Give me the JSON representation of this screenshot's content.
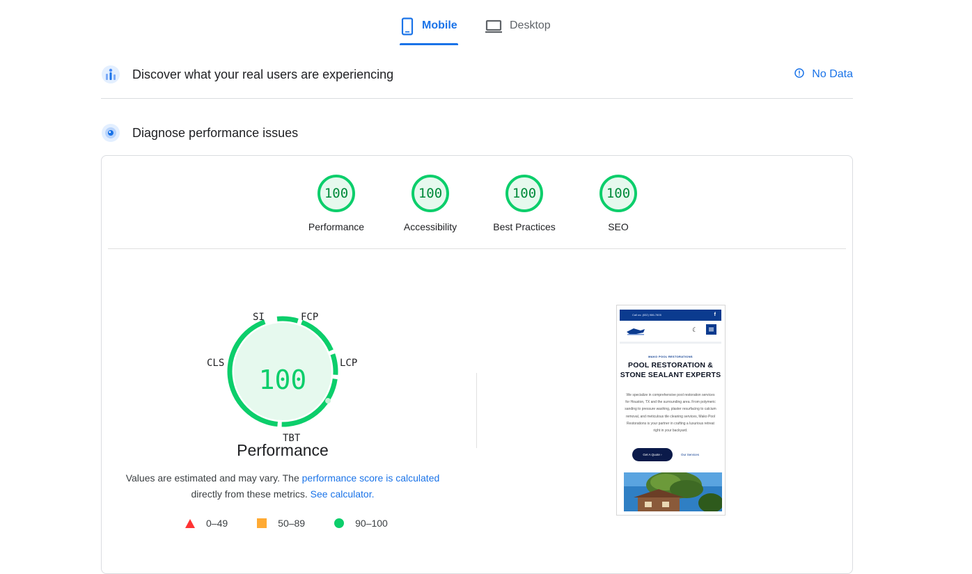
{
  "tabs": [
    {
      "label": "Mobile",
      "active": true,
      "icon": "phone-icon"
    },
    {
      "label": "Desktop",
      "active": false,
      "icon": "laptop-icon"
    }
  ],
  "field_data": {
    "title": "Discover what your real users are experiencing",
    "status": "No Data",
    "status_icon": "info-icon"
  },
  "diagnose": {
    "title": "Diagnose performance issues"
  },
  "categories": [
    {
      "score": "100",
      "label": "Performance"
    },
    {
      "score": "100",
      "label": "Accessibility"
    },
    {
      "score": "100",
      "label": "Best Practices"
    },
    {
      "score": "100",
      "label": "SEO"
    }
  ],
  "performance": {
    "score": "100",
    "title": "Performance",
    "metrics": [
      "SI",
      "FCP",
      "LCP",
      "TBT",
      "CLS"
    ],
    "note_pre": "Values are estimated and may vary. The ",
    "note_link1": "performance score is calculated",
    "note_mid": " directly from these metrics. ",
    "note_link2": "See calculator.",
    "legend": [
      {
        "range": "0–49",
        "shape": "triangle",
        "color": "#ff3333"
      },
      {
        "range": "50–89",
        "shape": "square",
        "color": "#ffaa33"
      },
      {
        "range": "90–100",
        "shape": "circle",
        "color": "#0cce6b"
      }
    ]
  },
  "colors": {
    "accent": "#1a73e8",
    "pass": "#0cce6b",
    "pass_text": "#008a3a"
  },
  "thumbnail": {
    "phone": "Call us: (832) 986-7805",
    "eyebrow": "MAKO POOL RESTORATIONS",
    "heading": "POOL RESTORATION & STONE SEALANT EXPERTS",
    "body": "We specialize in comprehensive pool restoration services for Houston, TX and the surrounding area. From polymeric sanding to pressure washing, plaster resurfacing to calcium removal, and meticulous tile cleaning services, Mako Pool Restorations is your partner in crafting a luxurious retreat right in your backyard.",
    "primary_button": "Get A Quote",
    "secondary_link": "Our Services"
  }
}
